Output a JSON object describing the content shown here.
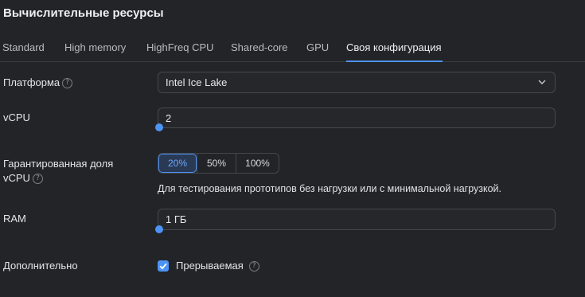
{
  "header": {
    "title": "Вычислительные ресурсы"
  },
  "tabs": [
    {
      "label": "Standard"
    },
    {
      "label": "High memory"
    },
    {
      "label": "HighFreq CPU"
    },
    {
      "label": "Shared-core"
    },
    {
      "label": "GPU"
    },
    {
      "label": "Своя конфигурация",
      "active": true
    }
  ],
  "platform": {
    "label": "Платформа",
    "value": "Intel Ice Lake"
  },
  "vcpu": {
    "label": "vCPU",
    "value": "2"
  },
  "guaranteed": {
    "label_line1": "Гарантированная доля",
    "label_line2": "vCPU",
    "options": [
      "20%",
      "50%",
      "100%"
    ],
    "selected": "20%",
    "hint": "Для тестирования прототипов без нагрузки или с минимальной нагрузкой."
  },
  "ram": {
    "label": "RAM",
    "value": "1 ГБ"
  },
  "additional": {
    "label": "Дополнительно",
    "checkbox_label": "Прерываемая",
    "checked": true
  },
  "help_glyph": "?",
  "colors": {
    "accent": "#4d93f5",
    "background": "#232427",
    "border": "#45474d"
  },
  "icons": {
    "help": "question-circle-icon",
    "dropdown": "chevron-down-icon",
    "check": "checkmark-icon"
  }
}
